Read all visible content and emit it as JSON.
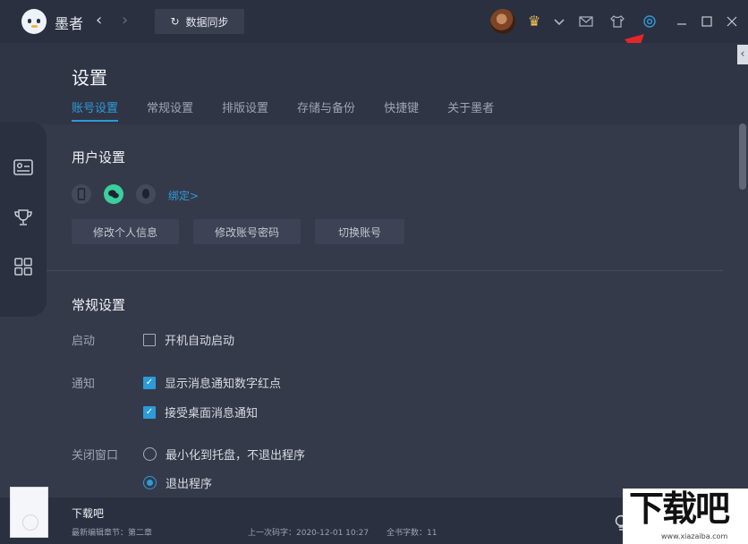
{
  "app": {
    "name": "墨者",
    "sync_label": "数据同步"
  },
  "top_icons": [
    "back-icon",
    "forward-icon",
    "crown-icon",
    "chevron-down-icon",
    "mail-icon",
    "shirt-icon",
    "settings-icon",
    "minimize-icon",
    "maximize-icon",
    "close-icon"
  ],
  "page": {
    "title": "设置",
    "tabs": [
      {
        "label": "账号设置",
        "active": true
      },
      {
        "label": "常规设置",
        "active": false
      },
      {
        "label": "排版设置",
        "active": false
      },
      {
        "label": "存储与备份",
        "active": false
      },
      {
        "label": "快捷键",
        "active": false
      },
      {
        "label": "关于墨者",
        "active": false
      }
    ]
  },
  "user_settings": {
    "title": "用户设置",
    "bind_link": "绑定>",
    "buttons": [
      "修改个人信息",
      "修改账号密码",
      "切换账号"
    ]
  },
  "general_settings": {
    "title": "常规设置",
    "startup": {
      "label": "启动",
      "option": "开机自动启动",
      "checked": false
    },
    "notify": {
      "label": "通知",
      "options": [
        {
          "text": "显示消息通知数字红点",
          "checked": true
        },
        {
          "text": "接受桌面消息通知",
          "checked": true
        }
      ]
    },
    "close_window": {
      "label": "关闭窗口",
      "options": [
        {
          "text": "最小化到托盘，不退出程序",
          "selected": false
        },
        {
          "text": "退出程序",
          "selected": true
        }
      ]
    }
  },
  "book": {
    "title": "下载吧",
    "last_chapter": "最新编辑章节：第二章",
    "last_word_count": "上一次码字：2020-12-01 10:27",
    "total_words": "全书字数：11"
  },
  "watermark": {
    "text": "下载吧",
    "url": "www.xiazaiba.com"
  },
  "colors": {
    "accent": "#2c9bd7",
    "background": "#353a4a",
    "titlebar": "#2b3040",
    "annotation_arrow": "#e3262a"
  }
}
